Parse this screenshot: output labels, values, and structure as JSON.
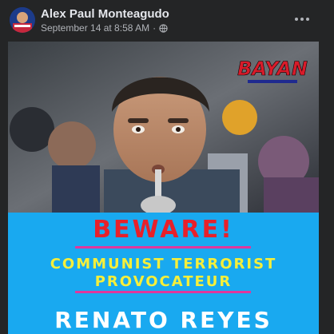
{
  "post": {
    "author": "Alex Paul Monteagudo",
    "date": "September 14 at 8:58 AM",
    "separator": "·",
    "privacy_icon": "globe-icon",
    "more_icon": "more-options-icon"
  },
  "poster": {
    "logo_text": "BAYAN",
    "headline": "BEWARE!",
    "tagline_line1": "COMMUNIST TERRORIST",
    "tagline_line2": "PROVOCATEUR",
    "name": "RENATO REYES"
  },
  "colors": {
    "poster_background": "#19a9f0",
    "headline": "#e8202a",
    "tagline": "#f6ef3a",
    "rule": "#e0379d",
    "name": "#ffffff"
  }
}
